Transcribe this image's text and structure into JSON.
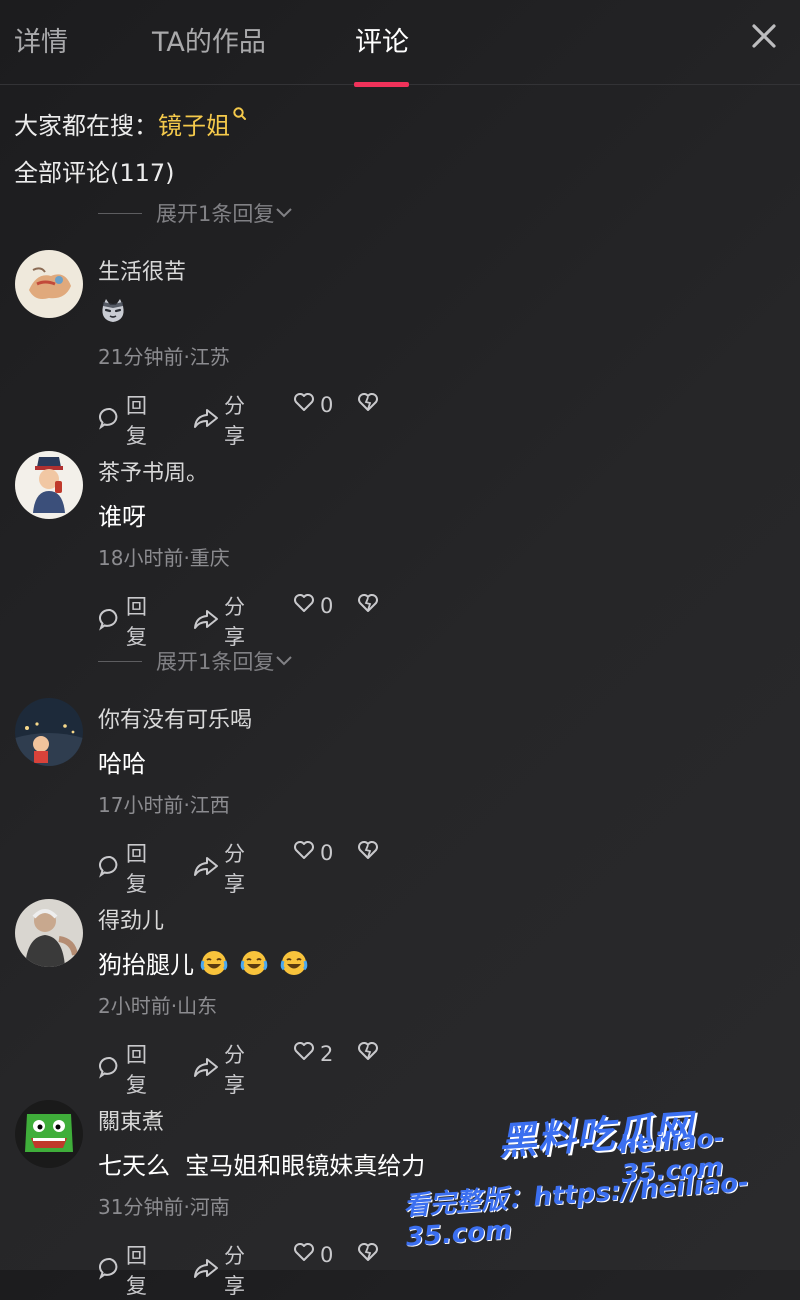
{
  "tabs": [
    {
      "label": "详情"
    },
    {
      "label": "TA的作品"
    },
    {
      "label": "评论"
    }
  ],
  "hot_search": {
    "prefix": "大家都在搜：",
    "keyword": "镜子姐"
  },
  "comment_count": "全部评论(117)",
  "expand_replies": "展开1条回复",
  "comments": [
    {
      "user": "生活很苦",
      "text": "",
      "meta": "21分钟前·江苏",
      "reply": "回复",
      "share": "分享",
      "likes": "0"
    },
    {
      "user": "茶予书周。",
      "text": "谁呀",
      "meta": "18小时前·重庆",
      "reply": "回复",
      "share": "分享",
      "likes": "0"
    },
    {
      "user": "你有没有可乐喝",
      "text": "哈哈",
      "meta": "17小时前·江西",
      "reply": "回复",
      "share": "分享",
      "likes": "0"
    },
    {
      "user": "得劲儿",
      "text": "狗抬腿儿",
      "meta": "2小时前·山东",
      "reply": "回复",
      "share": "分享",
      "likes": "2"
    },
    {
      "user": "關東煮",
      "text": "七天么  宝马姐和眼镜妹真给力",
      "meta": "31分钟前·河南",
      "reply": "回复",
      "share": "分享",
      "likes": "0"
    }
  ],
  "watermark": {
    "brand": "黑料吃瓜网",
    "url": "heiliao-35.com",
    "cta": "看完整版：https://heiliao-35.com"
  },
  "colors": {
    "accent": "#f0325a",
    "keyword": "#f4c94b",
    "background": "#1c1c1e"
  },
  "icons": [
    "close-icon",
    "search-icon",
    "comment-icon",
    "share-icon",
    "heart-icon",
    "broken-heart-icon"
  ]
}
